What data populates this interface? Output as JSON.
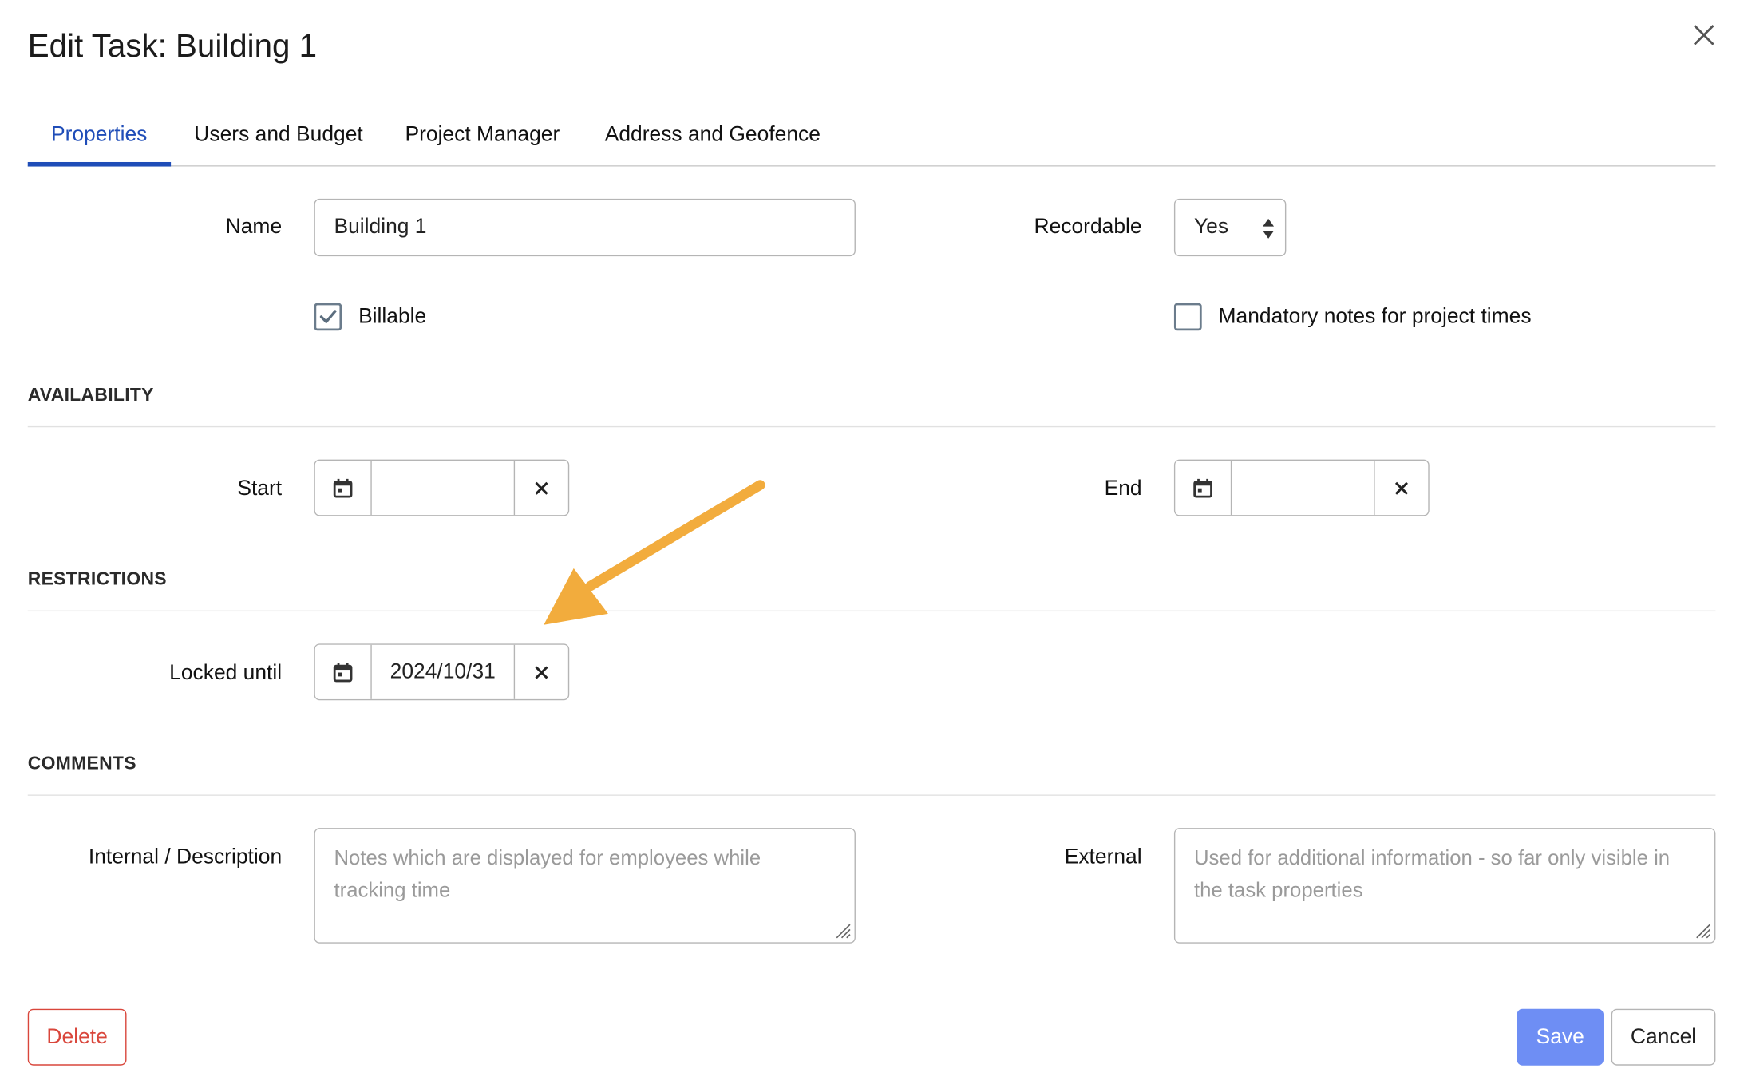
{
  "dialog": {
    "title": "Edit Task: Building 1",
    "close_icon": "close-icon"
  },
  "tabs": [
    {
      "label": "Properties",
      "active": true
    },
    {
      "label": "Users and Budget",
      "active": false
    },
    {
      "label": "Project Manager",
      "active": false
    },
    {
      "label": "Address and Geofence",
      "active": false
    }
  ],
  "properties": {
    "name_label": "Name",
    "name_value": "Building 1",
    "recordable_label": "Recordable",
    "recordable_value": "Yes",
    "billable_label": "Billable",
    "billable_checked": true,
    "mandatory_notes_label": "Mandatory notes for project times",
    "mandatory_notes_checked": false
  },
  "availability": {
    "heading": "AVAILABILITY",
    "start_label": "Start",
    "start_value": "",
    "end_label": "End",
    "end_value": ""
  },
  "restrictions": {
    "heading": "RESTRICTIONS",
    "locked_until_label": "Locked until",
    "locked_until_value": "2024/10/31"
  },
  "comments": {
    "heading": "COMMENTS",
    "internal_label": "Internal / Description",
    "internal_placeholder": "Notes which are displayed for employees while tracking time",
    "external_label": "External",
    "external_placeholder": "Used for additional information - so far only visible in the task properties"
  },
  "footer": {
    "delete_label": "Delete",
    "save_label": "Save",
    "cancel_label": "Cancel"
  },
  "colors": {
    "accent": "#1f4db8",
    "save_button": "#6e8ef4",
    "delete": "#d9463b",
    "annotation_arrow": "#f2ac3d"
  },
  "icons": {
    "calendar": "calendar-icon",
    "clear": "clear-x-icon",
    "check": "check-icon",
    "annotation": "annotation-arrow-icon"
  }
}
